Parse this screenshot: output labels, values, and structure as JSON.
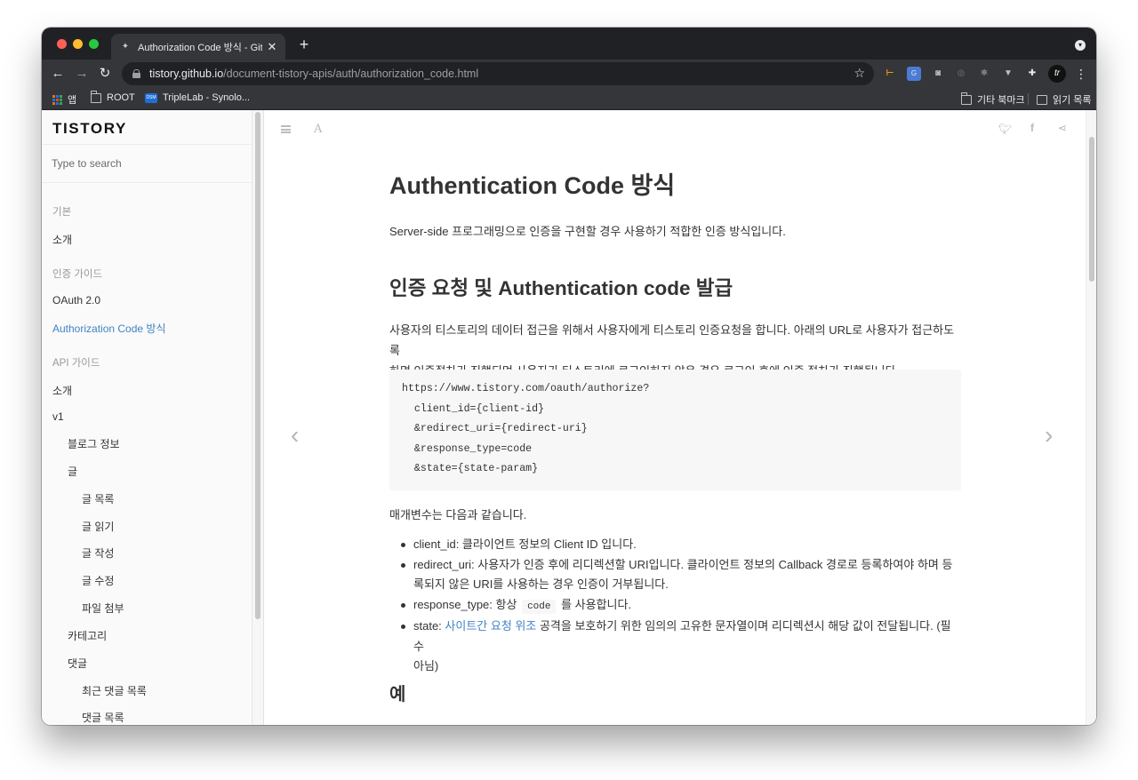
{
  "browser": {
    "tab_title": "Authorization Code 방식 - GitBo",
    "tab_favicon": "gitbook-icon",
    "new_tab_label": "+",
    "url_host": "tistory.github.io",
    "url_path": "/document-tistory-apis/auth/authorization_code.html",
    "avatar_text": "tr",
    "bookmarks": {
      "apps": "앱",
      "root": "ROOT",
      "triplelab": "TripleLab - Synolo...",
      "dsm_badge": "DSM",
      "other": "기타 북마크",
      "reading_list": "읽기 목록"
    }
  },
  "sidebar": {
    "logo": "TISTORY",
    "search_placeholder": "Type to search",
    "items": [
      {
        "label": "기본",
        "type": "header"
      },
      {
        "label": "소개",
        "type": "item"
      },
      {
        "label": "인증 가이드",
        "type": "header"
      },
      {
        "label": "OAuth 2.0",
        "type": "item"
      },
      {
        "label": "Authorization Code 방식",
        "type": "active"
      },
      {
        "label": "API 가이드",
        "type": "header"
      },
      {
        "label": "소개",
        "type": "item"
      },
      {
        "label": "v1",
        "type": "item"
      },
      {
        "label": "블로그 정보",
        "type": "item"
      },
      {
        "label": "글",
        "type": "item"
      },
      {
        "label": "글 목록",
        "type": "item"
      },
      {
        "label": "글 읽기",
        "type": "item"
      },
      {
        "label": "글 작성",
        "type": "item"
      },
      {
        "label": "글 수정",
        "type": "item"
      },
      {
        "label": "파일 첨부",
        "type": "item"
      },
      {
        "label": "카테고리",
        "type": "item"
      },
      {
        "label": "댓글",
        "type": "item"
      },
      {
        "label": "최근 댓글 목록",
        "type": "item"
      },
      {
        "label": "댓글 목록",
        "type": "item"
      }
    ]
  },
  "article": {
    "title": "Authentication Code 방식",
    "intro": "Server-side 프로그래밍으로 인증을 구현할 경우 사용하기 적합한 인증 방식입니다.",
    "section_title": "인증 요청 및 Authentication code 발급",
    "section_para_line1": "사용자의 티스토리의 데이터 접근을 위해서 사용자에게 티스토리 인증요청을 합니다. 아래의 URL로 사용자가 접근하도록",
    "section_para_line2": "하면 인증절차가 진행되며 사용자가 티스토리에 로그인하지 않은 경우 로그인 후에 인증 절차가 진행됩니다.",
    "code_lines": [
      "https://www.tistory.com/oauth/authorize?",
      "  client_id={client-id}",
      "  &redirect_uri={redirect-uri}",
      "  &response_type=code",
      "  &state={state-param}"
    ],
    "params_intro": "매개변수는 다음과 같습니다.",
    "params": {
      "client_id": "client_id: 클라이언트 정보의 Client ID 입니다.",
      "redirect_uri_line1": "redirect_uri: 사용자가 인증 후에 리디렉션할 URI입니다. 클라이언트 정보의 Callback 경로로 등록하여야 하며 등",
      "redirect_uri_line2": "록되지 않은 URI를 사용하는 경우 인증이 거부됩니다.",
      "response_type_prefix": "response_type: 항상",
      "response_type_code": "code",
      "response_type_suffix": "를 사용합니다.",
      "state_prefix": "state:",
      "state_link": "사이트간 요청 위조",
      "state_suffix_line1": "공격을 보호하기 위한 임의의 고유한 문자열이며 리디렉션시 해당 값이 전달됩니다. (필수",
      "state_suffix_line2": "아님)"
    },
    "example_title": "예"
  },
  "colors": {
    "link": "#4183c4",
    "chrome_dark": "#202124",
    "chrome_toolbar": "#35363a"
  }
}
